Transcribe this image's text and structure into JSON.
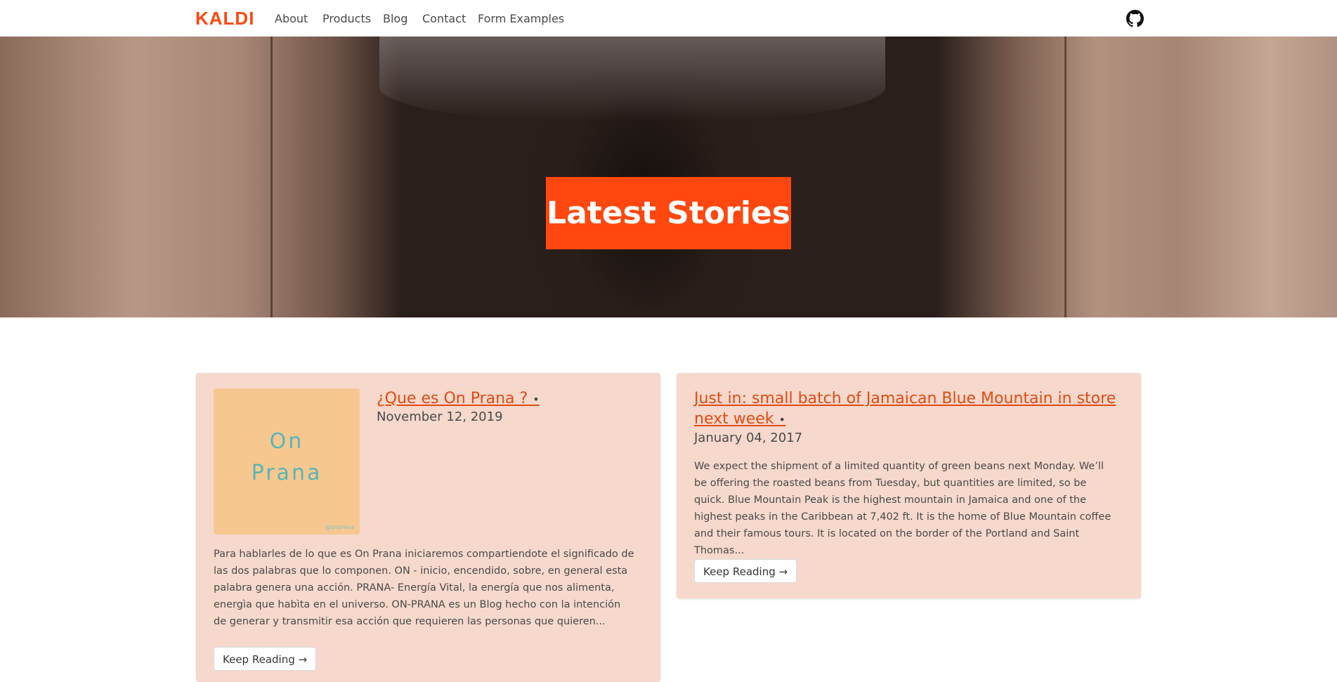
{
  "nav": {
    "brand": "KALDI",
    "links": [
      "About",
      "Products",
      "Blog",
      "Contact",
      "Form Examples"
    ],
    "github_icon": "github-icon"
  },
  "hero": {
    "title": "Latest Stories"
  },
  "posts": [
    {
      "title": "¿Que es On Prana ?",
      "separator": "•",
      "date": "November 12, 2019",
      "thumbnail": {
        "line1": "On",
        "line2": "Prana",
        "mark": "@onprana"
      },
      "excerpt": "Para hablarles de lo que es On Prana iniciaremos compartiendote el significado de las dos palabras que lo componen. ON - inicio, encendido, sobre, en general esta palabra genera una acción. PRANA- Energía Vital, la energía que nos alimenta, energìa que habìta en el universo. ON-PRANA es un Blog hecho con la intención de generar y transmitir esa acción que requieren las personas que quieren...",
      "button": "Keep Reading →"
    },
    {
      "title_line1": "Just in: small batch of Jamaican Blue Mountain in store",
      "title_line2": "next week",
      "separator": "•",
      "date": "January 04, 2017",
      "excerpt": "We expect the shipment of a limited quantity of green beans next Monday. We’ll be offering the roasted beans from Tuesday, but quantities are limited, so be quick. Blue Mountain Peak is the highest mountain in Jamaica and one of the highest peaks in the Caribbean at 7,402 ft. It is the home of Blue Mountain coffee and their famous tours. It is located on the border of the Portland and Saint Thomas...",
      "button": "Keep Reading →"
    }
  ],
  "colors": {
    "accent": "#ff470f",
    "card_bg": "#f6d8cc",
    "link": "#e04b12"
  }
}
